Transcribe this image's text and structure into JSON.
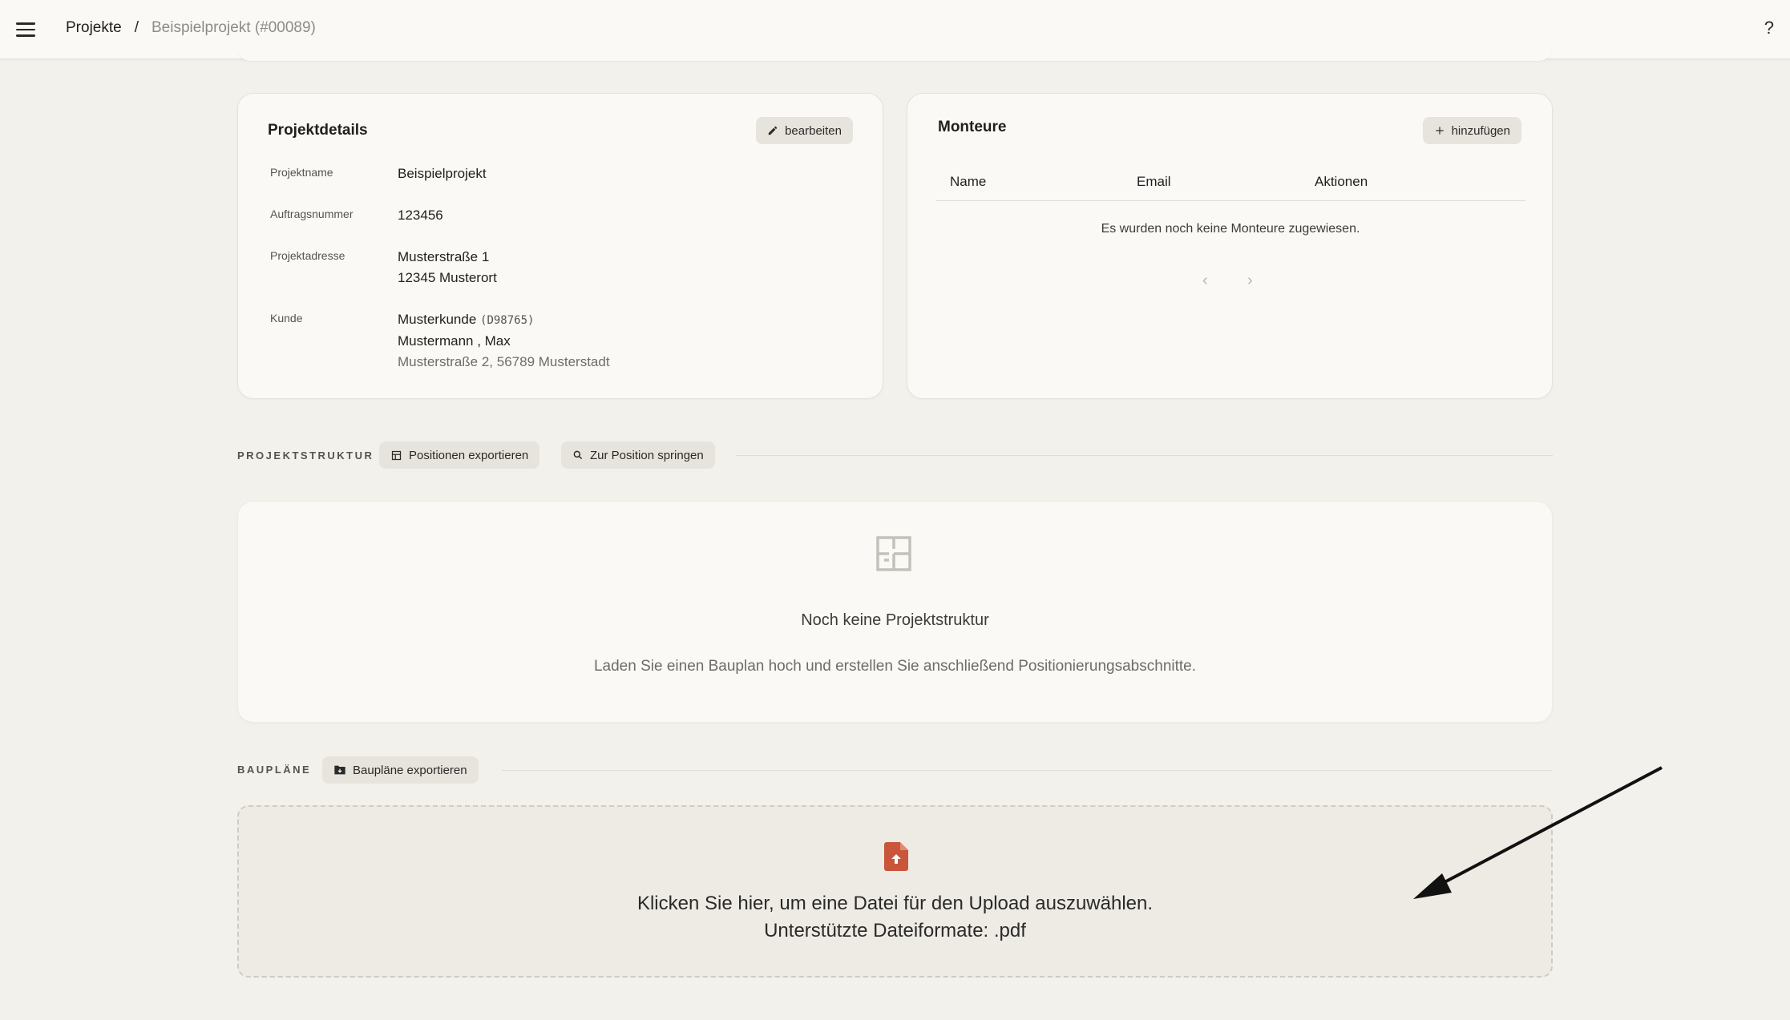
{
  "header": {
    "breadcrumb_root": "Projekte",
    "breadcrumb_sep": "/",
    "breadcrumb_current": "Beispielprojekt (#00089)",
    "help": "?"
  },
  "details": {
    "title": "Projektdetails",
    "edit_label": "bearbeiten",
    "rows": [
      {
        "label": "Projektname",
        "value": "Beispielprojekt"
      },
      {
        "label": "Auftragsnummer",
        "value": "123456"
      },
      {
        "label": "Projektadresse",
        "line1": "Musterstraße 1",
        "line2": "12345 Musterort"
      },
      {
        "label": "Kunde",
        "name": "Musterkunde",
        "code": "(D98765)",
        "contact": "Mustermann , Max",
        "address": "Musterstraße 2, 56789 Musterstadt"
      }
    ]
  },
  "monteure": {
    "title": "Monteure",
    "add_label": "hinzufügen",
    "columns": [
      "Name",
      "Email",
      "Aktionen"
    ],
    "empty": "Es wurden noch keine Monteure zugewiesen.",
    "prev": "‹",
    "next": "›"
  },
  "structure": {
    "label": "PROJEKTSTRUKTUR",
    "export_label": "Positionen exportieren",
    "jump_label": "Zur Position springen",
    "empty_title": "Noch keine Projektstruktur",
    "empty_text": "Laden Sie einen Bauplan hoch und erstellen Sie anschließend Positionierungsabschnitte."
  },
  "plans": {
    "label": "BAUPLÄNE",
    "export_label": "Baupläne exportieren",
    "upload_line1": "Klicken Sie hier, um eine Datei für den Upload auszuwählen.",
    "upload_line2": "Unterstützte Dateiformate: .pdf"
  },
  "colors": {
    "background": "#f3f1ec",
    "card": "#faf9f6",
    "chip": "#e7e4dd",
    "pdf_accent": "#c9553a"
  },
  "icons": [
    "menu-icon",
    "pencil-icon",
    "plus-icon",
    "table-icon",
    "search-icon",
    "floorplan-icon",
    "folder-icon",
    "pdf-upload-icon",
    "arrow-annotation"
  ]
}
